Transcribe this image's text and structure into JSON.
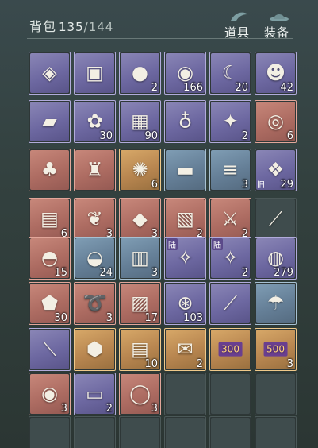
{
  "header": {
    "title": "背包",
    "capacity_used": "135",
    "capacity_sep": "/",
    "capacity_total": "144",
    "tabs": [
      {
        "label": "道具",
        "icon": "wing-icon"
      },
      {
        "label": "装备",
        "icon": "hat-icon"
      }
    ]
  },
  "rows": [
    [
      {
        "q": "purple",
        "icon": "map-fragment-icon",
        "glyph": "◈",
        "count": ""
      },
      {
        "q": "purple",
        "icon": "jewel-box-icon",
        "glyph": "▣",
        "count": ""
      },
      {
        "q": "purple",
        "icon": "gold-coin-icon",
        "glyph": "●",
        "count": "2"
      },
      {
        "q": "purple",
        "icon": "pink-orb-icon",
        "glyph": "◉",
        "count": "166"
      },
      {
        "q": "purple",
        "icon": "crescent-blade-icon",
        "glyph": "☾",
        "count": "20"
      },
      {
        "q": "purple",
        "icon": "dog-face-icon",
        "glyph": "☻",
        "count": "42"
      }
    ],
    [
      {
        "q": "purple",
        "icon": "blue-fabric-icon",
        "glyph": "▰",
        "count": ""
      },
      {
        "q": "purple",
        "icon": "gold-flowers-icon",
        "glyph": "✿",
        "count": "30"
      },
      {
        "q": "purple",
        "icon": "treasure-chest-icon",
        "glyph": "▦",
        "count": "90"
      },
      {
        "q": "purple",
        "icon": "blue-pouch-icon",
        "glyph": "♁",
        "count": ""
      },
      {
        "q": "purple",
        "icon": "gold-flame-icon",
        "glyph": "✦",
        "count": "2"
      },
      {
        "q": "red",
        "icon": "blue-eye-orb-icon",
        "glyph": "◎",
        "count": "6"
      }
    ],
    [
      {
        "q": "red",
        "icon": "gourd-icon",
        "glyph": "♣",
        "count": ""
      },
      {
        "q": "red",
        "icon": "jade-vase-icon",
        "glyph": "♜",
        "count": ""
      },
      {
        "q": "gold",
        "icon": "golden-aura-icon",
        "glyph": "✺",
        "count": "6"
      },
      {
        "q": "blue",
        "icon": "red-cake-icon",
        "glyph": "▬",
        "count": ""
      },
      {
        "q": "blue",
        "icon": "log-bundle-icon",
        "glyph": "≡",
        "count": "3"
      },
      {
        "q": "purple",
        "icon": "blue-porcelain-icon",
        "glyph": "❖",
        "count": "29",
        "badge2": "旧"
      }
    ],
    [
      {
        "q": "red",
        "icon": "talisman-paper-icon",
        "glyph": "▤",
        "count": "6"
      },
      {
        "q": "red",
        "icon": "berry-branch-icon",
        "glyph": "❦",
        "count": "3"
      },
      {
        "q": "red",
        "icon": "stone-chunk-icon",
        "glyph": "◆",
        "count": "3"
      },
      {
        "q": "red",
        "icon": "old-scroll-icon",
        "glyph": "▧",
        "count": "2"
      },
      {
        "q": "red",
        "icon": "gauntlet-icon",
        "glyph": "⚔",
        "count": "2"
      },
      {
        "q": "empty",
        "icon": "fishing-rod-icon",
        "glyph": "⟋",
        "count": ""
      }
    ],
    [
      {
        "q": "red",
        "icon": "rice-dumpling-icon",
        "glyph": "◓",
        "count": "15"
      },
      {
        "q": "blue",
        "icon": "chestnut-icon",
        "glyph": "◒",
        "count": "24"
      },
      {
        "q": "blue",
        "icon": "bamboo-scroll-icon",
        "glyph": "▥",
        "count": "3"
      },
      {
        "q": "purple",
        "icon": "lantern-icon",
        "glyph": "✧",
        "count": "",
        "badge": "陆"
      },
      {
        "q": "purple",
        "icon": "lantern-icon",
        "glyph": "✧",
        "count": "2",
        "badge": "陆"
      },
      {
        "q": "purple",
        "icon": "bronze-disc-icon",
        "glyph": "◍",
        "count": "279"
      }
    ],
    [
      {
        "q": "red",
        "icon": "iron-ore-icon",
        "glyph": "⬟",
        "count": "30"
      },
      {
        "q": "red",
        "icon": "jade-dragon-icon",
        "glyph": "➰",
        "count": "3"
      },
      {
        "q": "red",
        "icon": "red-ticket-icon",
        "glyph": "▨",
        "count": "17"
      },
      {
        "q": "purple",
        "icon": "blue-vortex-icon",
        "glyph": "⊛",
        "count": "103"
      },
      {
        "q": "purple",
        "icon": "green-flute-icon",
        "glyph": "⟋",
        "count": ""
      },
      {
        "q": "blue",
        "icon": "red-umbrella-icon",
        "glyph": "☂",
        "count": ""
      }
    ],
    [
      {
        "q": "purple",
        "icon": "spear-icon",
        "glyph": "⟍",
        "count": ""
      },
      {
        "q": "gold",
        "icon": "gold-ingot-icon",
        "glyph": "⬢",
        "count": ""
      },
      {
        "q": "gold",
        "icon": "outfit-book-icon",
        "glyph": "▤",
        "count": "10"
      },
      {
        "q": "gold",
        "icon": "red-envelope-icon",
        "glyph": "✉",
        "count": "2"
      },
      {
        "q": "gold",
        "icon": "discount-coupon-300-icon",
        "glyph": "300",
        "count": ""
      },
      {
        "q": "gold",
        "icon": "discount-coupon-500-icon",
        "glyph": "500",
        "count": "3"
      }
    ],
    [
      {
        "q": "red",
        "icon": "crystal-ball-icon",
        "glyph": "◉",
        "count": "3"
      },
      {
        "q": "purple",
        "icon": "silver-ingot-icon",
        "glyph": "▭",
        "count": "2"
      },
      {
        "q": "red",
        "icon": "bronze-bowl-icon",
        "glyph": "◯",
        "count": "3"
      },
      {
        "q": "empty",
        "icon": "",
        "glyph": "",
        "count": ""
      },
      {
        "q": "empty",
        "icon": "",
        "glyph": "",
        "count": ""
      },
      {
        "q": "empty",
        "icon": "",
        "glyph": "",
        "count": ""
      }
    ],
    [
      {
        "q": "empty",
        "icon": "",
        "glyph": "",
        "count": ""
      },
      {
        "q": "empty",
        "icon": "",
        "glyph": "",
        "count": ""
      },
      {
        "q": "empty",
        "icon": "",
        "glyph": "",
        "count": ""
      },
      {
        "q": "empty",
        "icon": "",
        "glyph": "",
        "count": ""
      },
      {
        "q": "empty",
        "icon": "",
        "glyph": "",
        "count": ""
      },
      {
        "q": "empty",
        "icon": "",
        "glyph": "",
        "count": ""
      }
    ]
  ]
}
